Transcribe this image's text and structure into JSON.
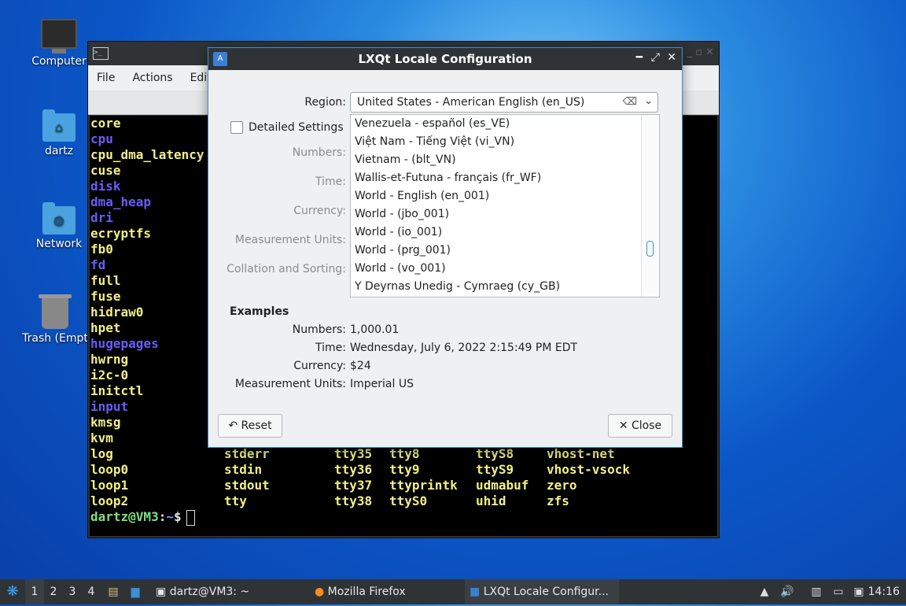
{
  "desktop": {
    "icons": [
      {
        "label": "Computer"
      },
      {
        "label": "dartz"
      },
      {
        "label": "Network"
      },
      {
        "label": "Trash (Empt"
      }
    ]
  },
  "terminal": {
    "menu": [
      "File",
      "Actions",
      "Edit"
    ],
    "col1": [
      {
        "t": "core",
        "c": "yellow"
      },
      {
        "t": "cpu",
        "c": "blue"
      },
      {
        "t": "cpu_dma_latency",
        "c": "yellow"
      },
      {
        "t": "cuse",
        "c": "yellow"
      },
      {
        "t": "disk",
        "c": "blue"
      },
      {
        "t": "dma_heap",
        "c": "blue"
      },
      {
        "t": "dri",
        "c": "blue"
      },
      {
        "t": "ecryptfs",
        "c": "yellow"
      },
      {
        "t": "fb0",
        "c": "yellow"
      },
      {
        "t": "fd",
        "c": "blue"
      },
      {
        "t": "full",
        "c": "yellow"
      },
      {
        "t": "fuse",
        "c": "yellow"
      },
      {
        "t": "hidraw0",
        "c": "yellow"
      },
      {
        "t": "hpet",
        "c": "yellow"
      },
      {
        "t": "hugepages",
        "c": "blue"
      },
      {
        "t": "hwrng",
        "c": "yellow"
      },
      {
        "t": "i2c-0",
        "c": "yellow"
      },
      {
        "t": "initctl",
        "c": "yellow"
      },
      {
        "t": "input",
        "c": "blue"
      },
      {
        "t": "kmsg",
        "c": "yellow"
      },
      {
        "t": "kvm",
        "c": "yellow"
      },
      {
        "t": "log",
        "c": "yellow"
      },
      {
        "t": "loop0",
        "c": "yellow"
      },
      {
        "t": "loop1",
        "c": "yellow"
      },
      {
        "t": "loop2",
        "c": "yellow"
      }
    ],
    "bottom_cols": [
      [
        "stderr",
        "stdin",
        "stdout",
        "tty"
      ],
      [
        "tty35",
        "tty36",
        "tty37",
        "tty38"
      ],
      [
        "tty8",
        "tty9",
        "ttyprintk",
        "ttyS0"
      ],
      [
        "ttyS8",
        "ttyS9",
        "udmabuf",
        "uhid"
      ],
      [
        "vhost-net",
        "vhost-vsock",
        "zero",
        "zfs"
      ]
    ],
    "prompt_user": "dartz@VM3",
    "prompt_sep": ":",
    "prompt_path": "~",
    "prompt_sym": "$"
  },
  "dialog": {
    "title": "LXQt Locale Configuration",
    "region_label": "Region:",
    "region_value": "United States - American English (en_US)",
    "detailed_label": "Detailed Settings",
    "numbers_label": "Numbers:",
    "time_label": "Time:",
    "currency_label": "Currency:",
    "measurement_label": "Measurement Units:",
    "collation_label": "Collation and Sorting:",
    "dropdown_items": [
      "Venezuela - español (es_VE)",
      "Việt Nam - Tiếng Việt (vi_VN)",
      "Vietnam -  (blt_VN)",
      "Wallis-et-Futuna - français (fr_WF)",
      "World - English (en_001)",
      "World -  (jbo_001)",
      "World -  (io_001)",
      "World -  (prg_001)",
      "World -  (vo_001)",
      "Y Deyrnas Unedig - Cymraeg (cy_GB)"
    ],
    "examples_heading": "Examples",
    "ex_numbers_label": "Numbers:",
    "ex_numbers": "1,000.01",
    "ex_time_label": "Time:",
    "ex_time": "Wednesday, July 6, 2022 2:15:49 PM EDT",
    "ex_currency_label": "Currency:",
    "ex_currency": "$24",
    "ex_measure_label": "Measurement Units:",
    "ex_measure": "Imperial US",
    "reset_label": "Reset",
    "close_label": "Close"
  },
  "taskbar": {
    "workspaces": [
      "1",
      "2",
      "3",
      "4"
    ],
    "tasks": [
      {
        "label": "dartz@VM3: ~"
      },
      {
        "label": "Mozilla Firefox"
      },
      {
        "label": "LXQt Locale Configur..."
      }
    ],
    "clock": "14:16"
  }
}
